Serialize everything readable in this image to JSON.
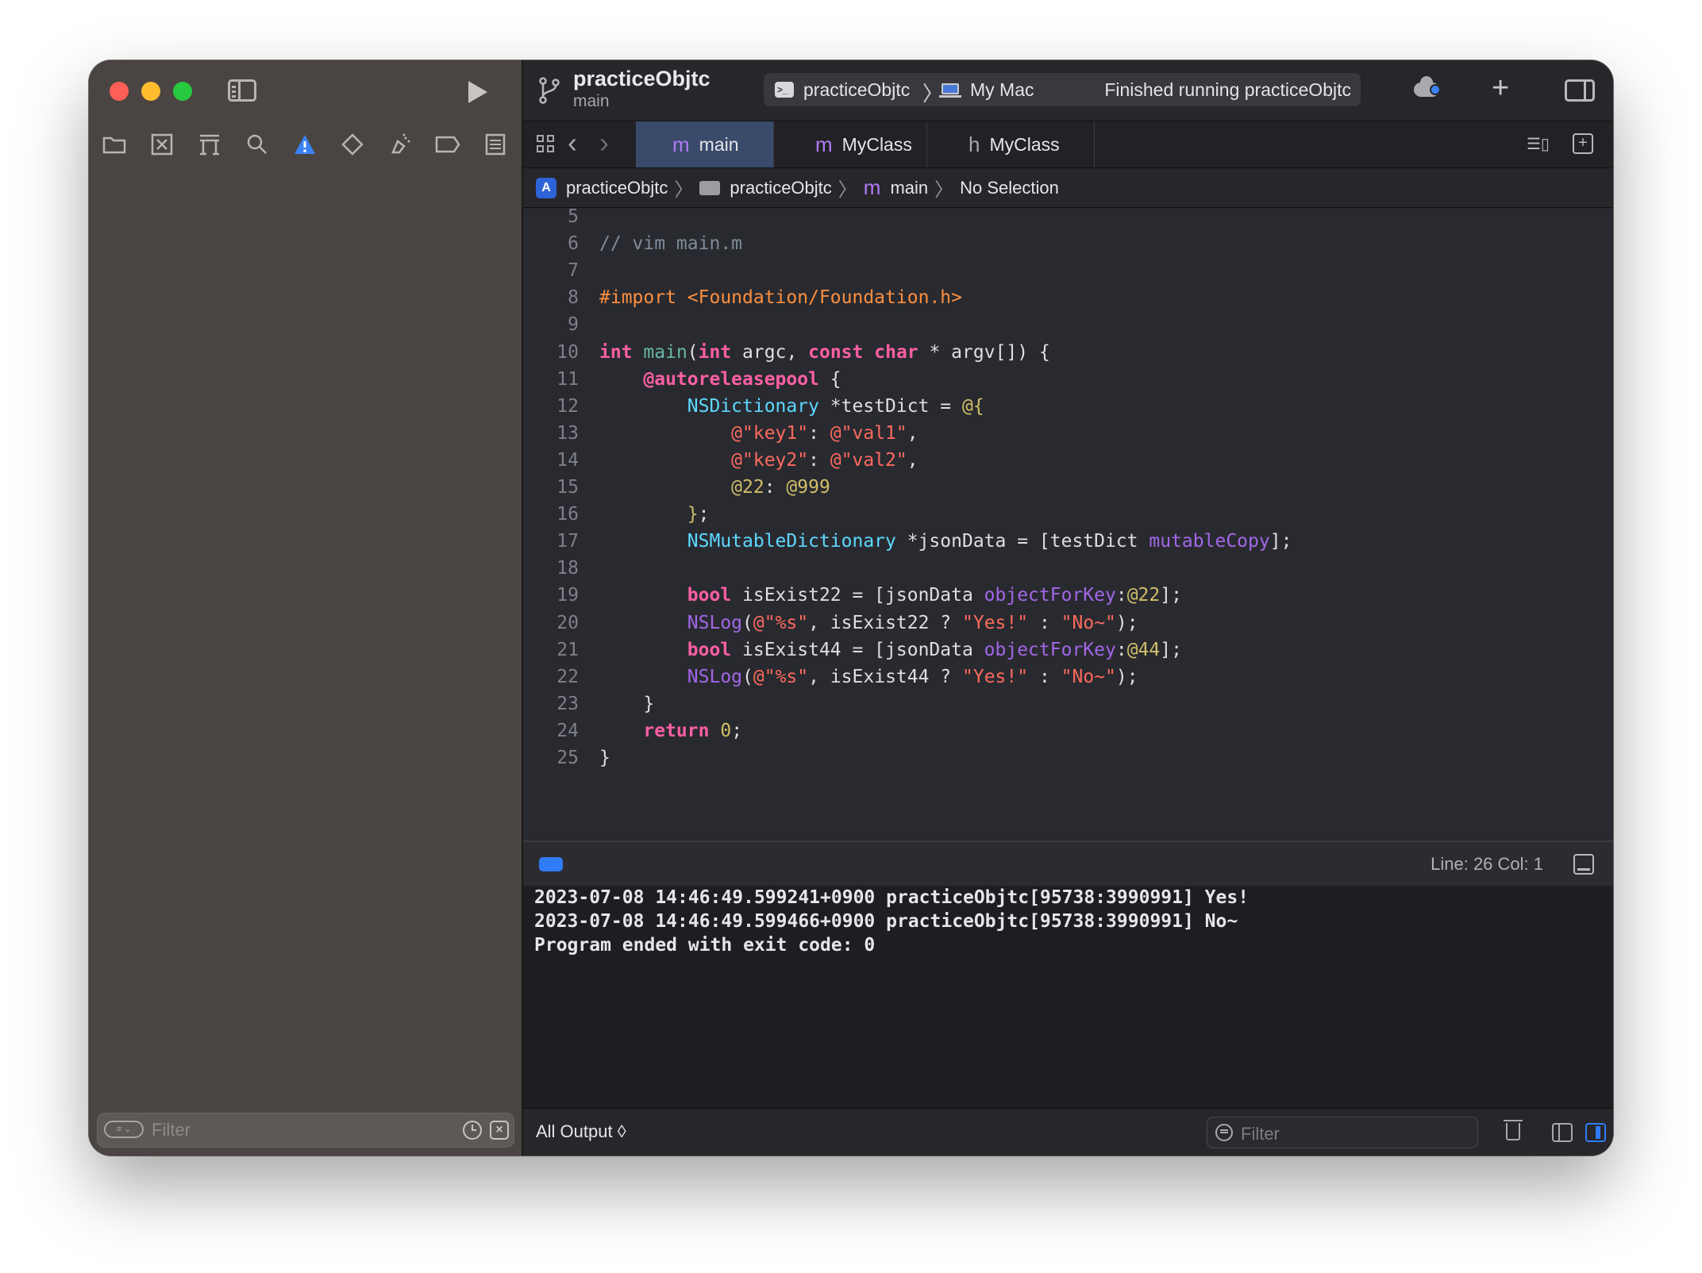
{
  "sidebar": {
    "nav_icons": [
      "folder-icon",
      "source-control-icon",
      "symbol-icon",
      "find-icon",
      "issue-warning-icon",
      "test-icon",
      "debug-icon",
      "breakpoint-icon",
      "report-icon"
    ],
    "filter_placeholder": "Filter"
  },
  "toolbar": {
    "project_name": "practiceObjtc",
    "branch": "main",
    "scheme_name": "practiceObjtc",
    "destination": "My Mac",
    "status": "Finished running practiceObjtc"
  },
  "tabs": [
    {
      "icon": "m",
      "label": "main",
      "active": true
    },
    {
      "icon": "m",
      "label": "MyClass",
      "active": false
    },
    {
      "icon": "h",
      "label": "MyClass",
      "active": false
    }
  ],
  "breadcrumb": {
    "project": "practiceObjtc",
    "folder": "practiceObjtc",
    "file": "main",
    "selection": "No Selection"
  },
  "editor": {
    "lines": [
      {
        "n": "5",
        "html": ""
      },
      {
        "n": "6",
        "html": "<span class='c-com'>// vim main.m</span>"
      },
      {
        "n": "7",
        "html": ""
      },
      {
        "n": "8",
        "html": "<span class='c-pre'>#import &lt;Foundation/Foundation.h&gt;</span>"
      },
      {
        "n": "9",
        "html": ""
      },
      {
        "n": "10",
        "html": "<span class='c-kw'>int</span> <span class='c-fn'>main</span>(<span class='c-kw'>int</span> argc, <span class='c-kw'>const</span> <span class='c-kw'>char</span> * argv[]) {"
      },
      {
        "n": "11",
        "html": "    <span class='c-attr'>@autoreleasepool</span> {"
      },
      {
        "n": "12",
        "html": "        <span class='c-cls'>NSDictionary</span> *testDict = <span class='c-num'>@{</span>"
      },
      {
        "n": "13",
        "html": "            <span class='c-str'>@\"key1\"</span>: <span class='c-str'>@\"val1\"</span>,"
      },
      {
        "n": "14",
        "html": "            <span class='c-str'>@\"key2\"</span>: <span class='c-str'>@\"val2\"</span>,"
      },
      {
        "n": "15",
        "html": "            <span class='c-num'>@22</span>: <span class='c-num'>@999</span>"
      },
      {
        "n": "16",
        "html": "        <span class='c-num'>}</span>;"
      },
      {
        "n": "17",
        "html": "        <span class='c-cls'>NSMutableDictionary</span> *jsonData = [testDict <span class='c-meth'>mutableCopy</span>];"
      },
      {
        "n": "18",
        "html": ""
      },
      {
        "n": "19",
        "html": "        <span class='c-kw'>bool</span> isExist22 = [jsonData <span class='c-meth'>objectForKey</span>:<span class='c-num'>@22</span>];"
      },
      {
        "n": "20",
        "html": "        <span class='c-meth'>NSLog</span>(<span class='c-str'>@\"%s\"</span>, isExist22 ? <span class='c-str'>\"Yes!\"</span> : <span class='c-str'>\"No~\"</span>);"
      },
      {
        "n": "21",
        "html": "        <span class='c-kw'>bool</span> isExist44 = [jsonData <span class='c-meth'>objectForKey</span>:<span class='c-num'>@44</span>];"
      },
      {
        "n": "22",
        "html": "        <span class='c-meth'>NSLog</span>(<span class='c-str'>@\"%s\"</span>, isExist44 ? <span class='c-str'>\"Yes!\"</span> : <span class='c-str'>\"No~\"</span>);"
      },
      {
        "n": "23",
        "html": "    }"
      },
      {
        "n": "24",
        "html": "    <span class='c-kw'>return</span> <span class='c-num'>0</span>;"
      },
      {
        "n": "25",
        "html": "}"
      }
    ]
  },
  "debugbar": {
    "line_col": "Line: 26  Col: 1"
  },
  "console": {
    "lines": [
      "2023-07-08 14:46:49.599241+0900 practiceObjtc[95738:3990991] Yes!",
      "2023-07-08 14:46:49.599466+0900 practiceObjtc[95738:3990991] No~",
      "Program ended with exit code: 0"
    ],
    "output_selector": "All Output ◊",
    "filter_placeholder": "Filter"
  }
}
